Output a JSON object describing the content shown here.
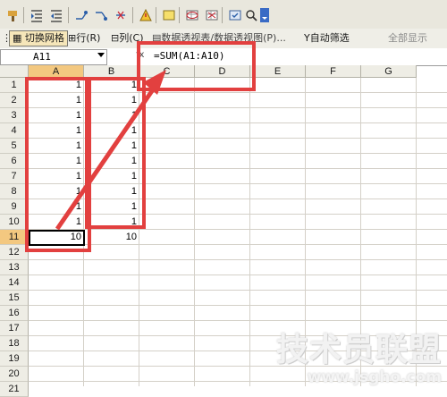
{
  "toolbar2": {
    "switch_grid": "切换网格",
    "row": "行",
    "row_key": "(R)",
    "col": "列",
    "col_key": "(C)",
    "pivot": "数据透视表/数据透视图(P)...",
    "autofilter": "自动筛选",
    "show_all": "全部显示"
  },
  "formula_bar": {
    "name_box": "A11",
    "fx": "fx",
    "formula": "=SUM(A1:A10)"
  },
  "columns": [
    "A",
    "B",
    "C",
    "D",
    "E",
    "F",
    "G"
  ],
  "rows": [
    "1",
    "2",
    "3",
    "4",
    "5",
    "6",
    "7",
    "8",
    "9",
    "10",
    "11",
    "12",
    "13",
    "14",
    "15",
    "16",
    "17",
    "18",
    "19",
    "20",
    "21"
  ],
  "cells": {
    "A": [
      "1",
      "1",
      "1",
      "1",
      "1",
      "1",
      "1",
      "1",
      "1",
      "1",
      "10"
    ],
    "B": [
      "1",
      "1",
      "1",
      "1",
      "1",
      "1",
      "1",
      "1",
      "1",
      "1",
      "10"
    ]
  },
  "watermark": {
    "title": "技术员联盟",
    "url": "www.jsgho.com"
  },
  "colors": {
    "annotation": "#e2403f",
    "selected_header": "#f3c880"
  }
}
